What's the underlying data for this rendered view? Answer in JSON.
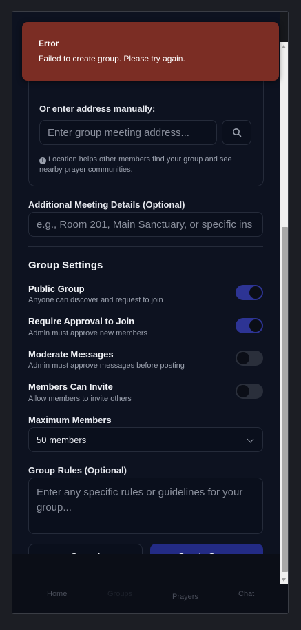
{
  "form": {
    "manual_address_label": "Or enter address manually:",
    "address_placeholder": "Enter group meeting address...",
    "location_hint": "Location helps other members find your group and see nearby prayer communities.",
    "details_label": "Additional Meeting Details (Optional)",
    "details_placeholder": "e.g., Room 201, Main Sanctuary, or specific ins",
    "settings_title": "Group Settings",
    "settings": [
      {
        "title": "Public Group",
        "desc": "Anyone can discover and request to join",
        "enabled": true
      },
      {
        "title": "Require Approval to Join",
        "desc": "Admin must approve new members",
        "enabled": true
      },
      {
        "title": "Moderate Messages",
        "desc": "Admin must approve messages before posting",
        "enabled": false
      },
      {
        "title": "Members Can Invite",
        "desc": "Allow members to invite others",
        "enabled": false
      }
    ],
    "max_members_label": "Maximum Members",
    "max_members_value": "50 members",
    "rules_label": "Group Rules (Optional)",
    "rules_placeholder": "Enter any specific rules or guidelines for your group...",
    "cancel_label": "Cancel",
    "create_label": "Create Group"
  },
  "nav": {
    "items": [
      "Home",
      "Groups",
      "Prayers",
      "Chat"
    ]
  },
  "toast": {
    "title": "Error",
    "message": "Failed to create group. Please try again."
  },
  "colors": {
    "accent": "#232b85",
    "toggle_on": "#2d3494",
    "error": "#7b2d24",
    "background": "#0d1220"
  }
}
